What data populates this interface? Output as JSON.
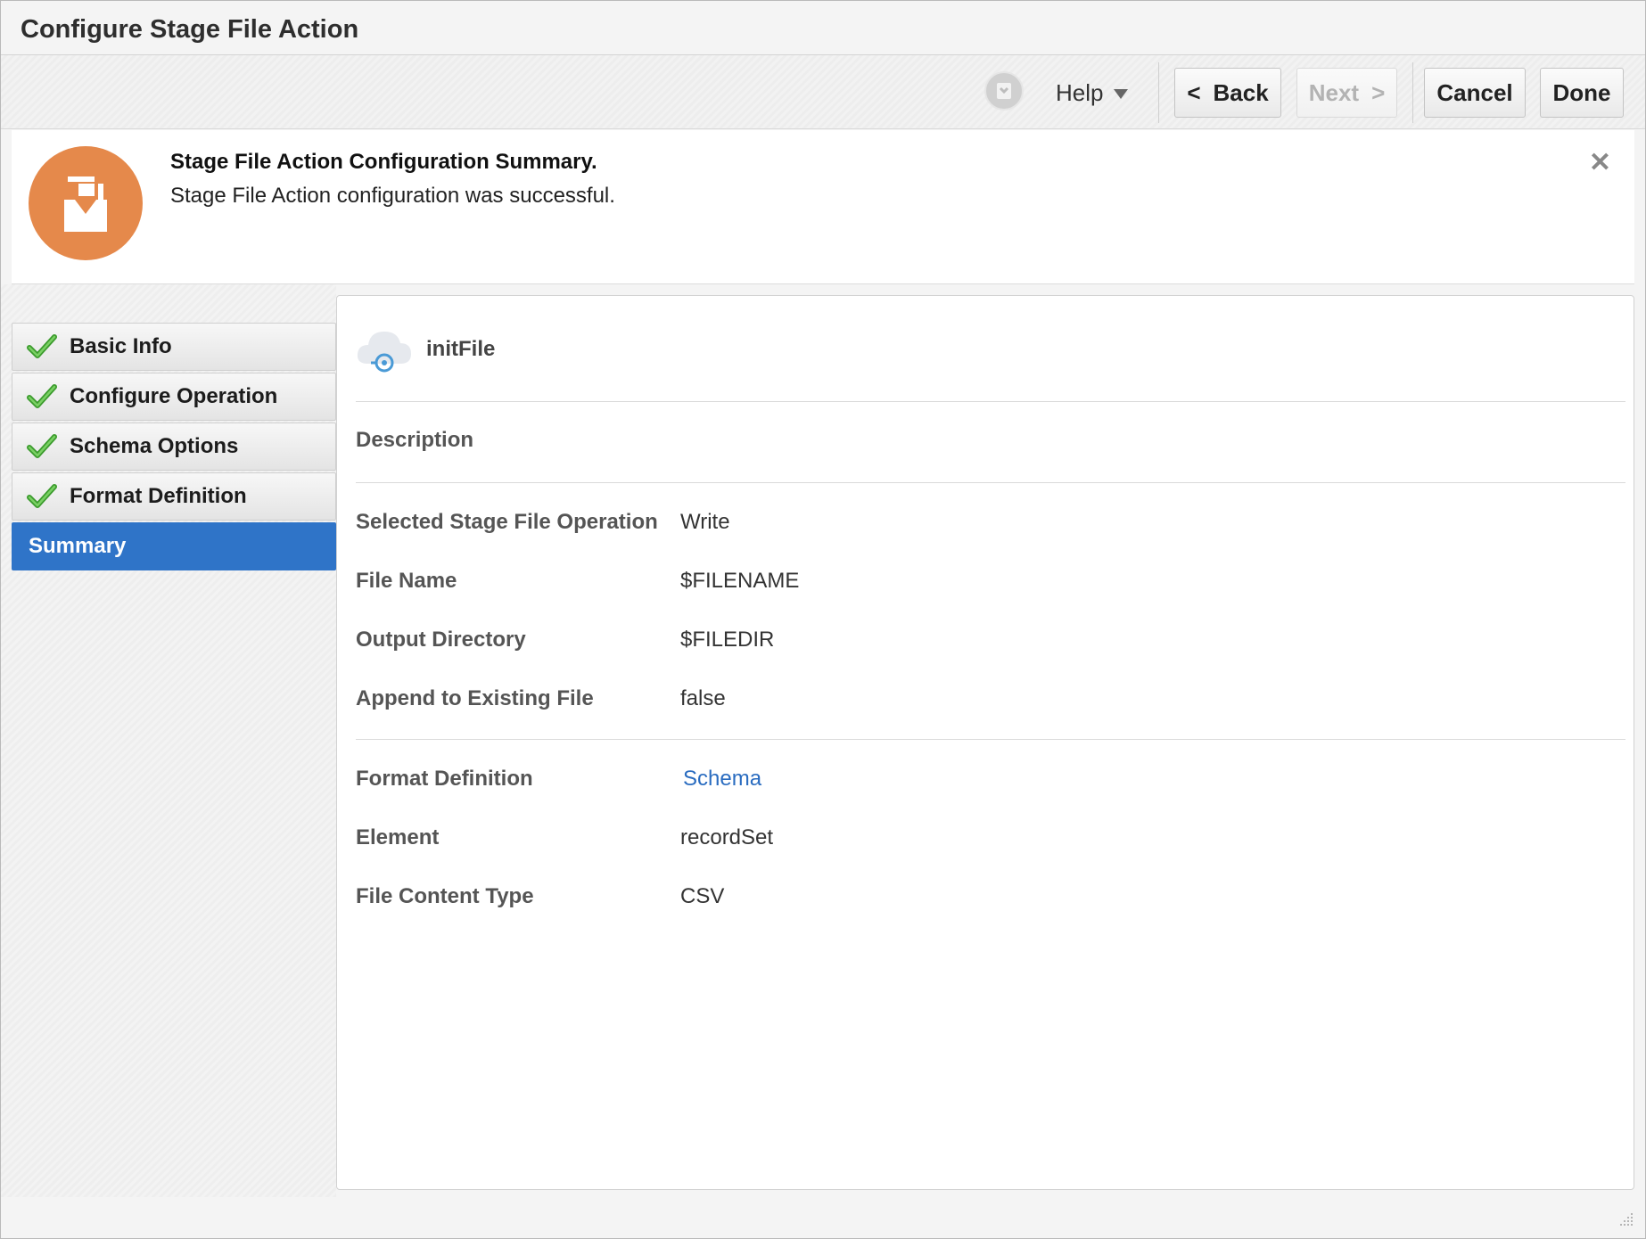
{
  "window": {
    "title": "Configure Stage File Action"
  },
  "toolbar": {
    "user_icon": "user-avatar-icon",
    "help_label": "Help",
    "back_label": "Back",
    "back_prefix": "<",
    "next_label": "Next",
    "next_suffix": ">",
    "cancel_label": "Cancel",
    "done_label": "Done"
  },
  "banner": {
    "title": "Stage File Action Configuration Summary.",
    "message": "Stage File Action configuration was successful.",
    "close": "✕",
    "icon": "stage-file-icon",
    "icon_color": "#e5894b"
  },
  "nav": {
    "items": [
      {
        "label": "Basic Info",
        "status": "complete"
      },
      {
        "label": "Configure Operation",
        "status": "complete"
      },
      {
        "label": "Schema Options",
        "status": "complete"
      },
      {
        "label": "Format Definition",
        "status": "complete"
      },
      {
        "label": "Summary",
        "status": "active"
      }
    ],
    "active_color": "#2f74c8"
  },
  "summary": {
    "action_name": "initFile",
    "description_label": "Description",
    "operation": [
      {
        "label": "Selected Stage File Operation",
        "value": "Write"
      },
      {
        "label": "File Name",
        "value": "$FILENAME"
      },
      {
        "label": "Output Directory",
        "value": "$FILEDIR"
      },
      {
        "label": "Append to Existing File",
        "value": "false"
      }
    ],
    "format": [
      {
        "label": "Format Definition",
        "value": "Schema"
      },
      {
        "label": "Element",
        "value": "recordSet"
      },
      {
        "label": "File Content Type",
        "value": "CSV"
      }
    ],
    "link_color": "#2a6cc0"
  }
}
